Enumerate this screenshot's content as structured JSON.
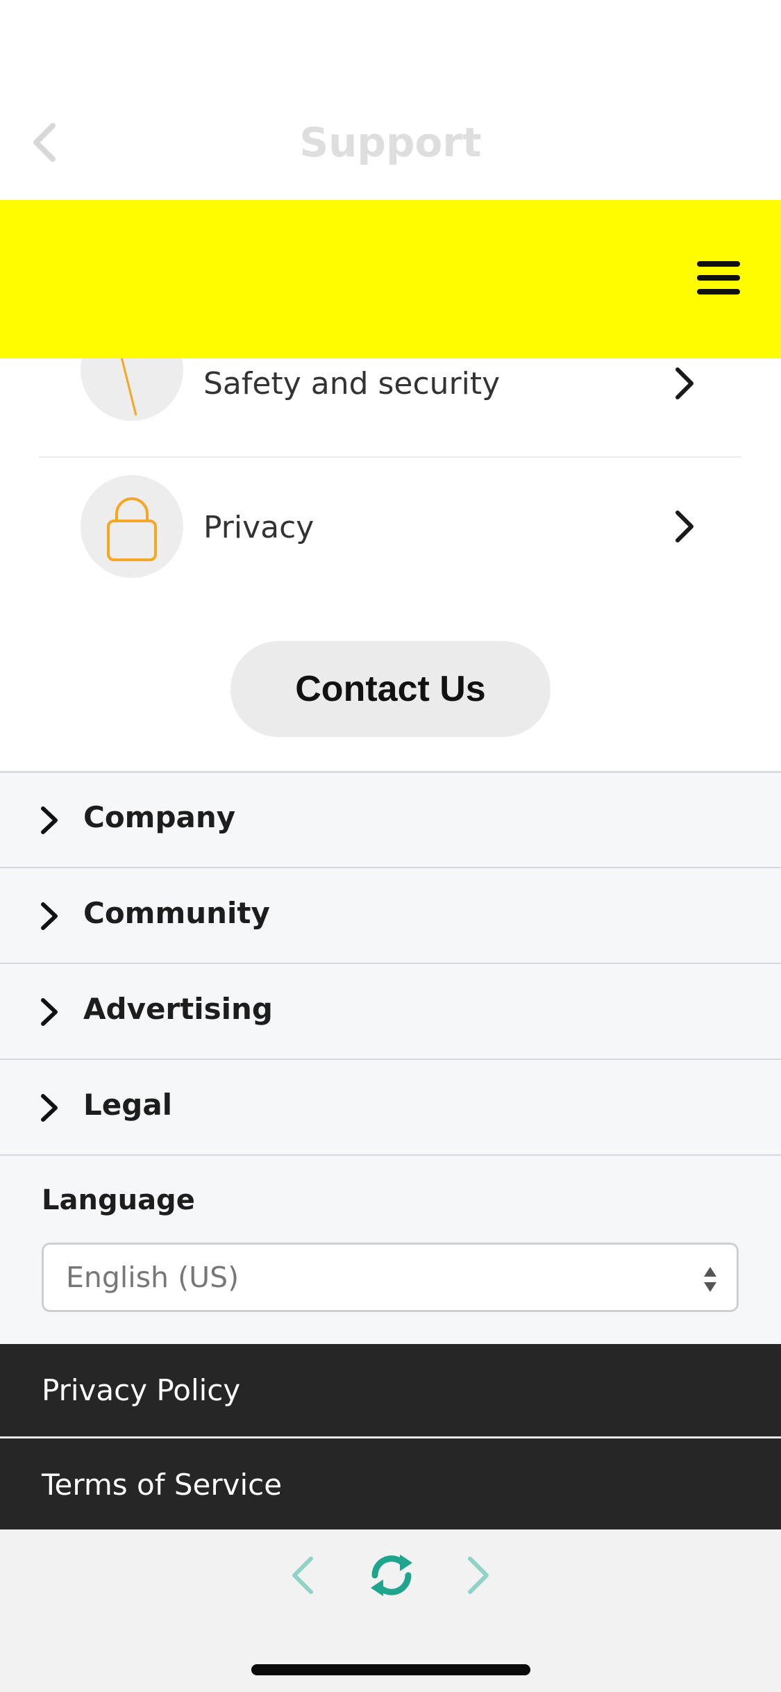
{
  "nav": {
    "title": "Support"
  },
  "categories": [
    {
      "label": "Safety and security",
      "icon": "flag-icon"
    },
    {
      "label": "Privacy",
      "icon": "lock-icon"
    }
  ],
  "contact": {
    "label": "Contact Us"
  },
  "footer": {
    "sections": [
      {
        "label": "Company"
      },
      {
        "label": "Community"
      },
      {
        "label": "Advertising"
      },
      {
        "label": "Legal"
      }
    ],
    "language": {
      "label": "Language",
      "selected": "English (US)"
    },
    "links": [
      {
        "label": "Privacy Policy"
      },
      {
        "label": "Terms of Service"
      }
    ]
  },
  "colors": {
    "brand": "#FFFC00",
    "accent_icon": "#F5A623",
    "toolbar_accent": "#1FA58D"
  }
}
